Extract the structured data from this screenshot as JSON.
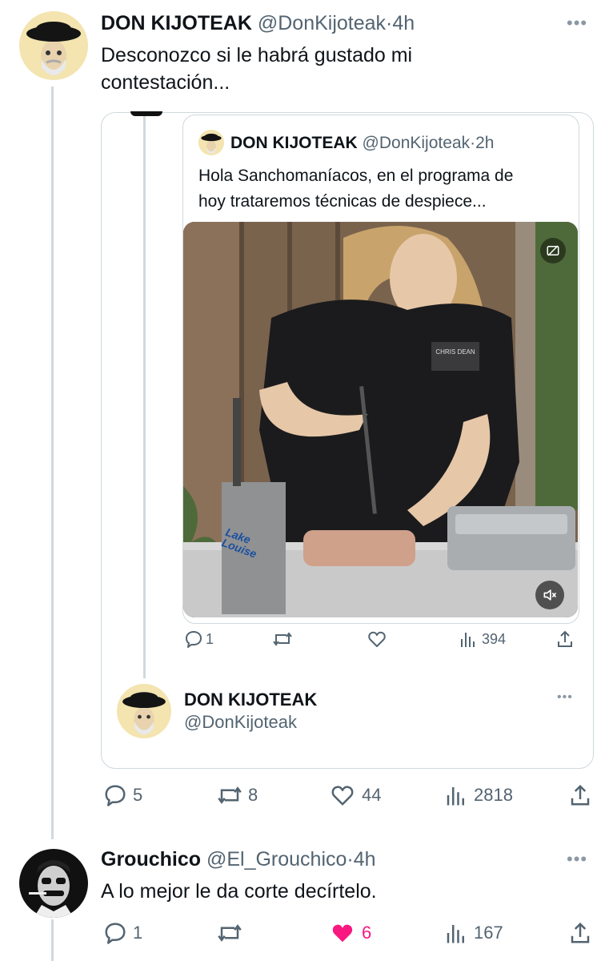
{
  "tweet1": {
    "name": "DON KIJOTEAK",
    "handle": "@DonKijoteak",
    "sep": "·",
    "time": "4h",
    "text_line1": "Desconozco si le habrá gustado mi",
    "text_line2": "contestación...",
    "actions": {
      "replies": "5",
      "retweets": "8",
      "likes": "44",
      "views": "2818"
    }
  },
  "quoted": {
    "name": "DON KIJOTEAK",
    "handle": "@DonKijoteak",
    "sep": "·",
    "time": "2h",
    "text_line1": "Hola Sanchomaníacos, en el programa de",
    "text_line2": "hoy trataremos técnicas de despiece...",
    "video": {
      "box_brand_line1": "Lake",
      "box_brand_line2": "Louise",
      "shirt_print": "CHRIS DEAN"
    },
    "actions": {
      "replies": "1",
      "retweets": "",
      "likes": "",
      "views": "394"
    }
  },
  "profile_card": {
    "name": "DON KIJOTEAK",
    "handle": "@DonKijoteak"
  },
  "tweet2": {
    "name": "Grouchico",
    "handle": "@El_Grouchico",
    "sep": "·",
    "time": "4h",
    "text": "A lo mejor le da corte decírtelo.",
    "actions": {
      "replies": "1",
      "retweets": "",
      "likes": "6",
      "views": "167"
    }
  },
  "more_glyph": "•••",
  "colors": {
    "text": "#0f1419",
    "secondary": "#536471",
    "border": "#cfd9de",
    "like_active": "#f91880"
  }
}
